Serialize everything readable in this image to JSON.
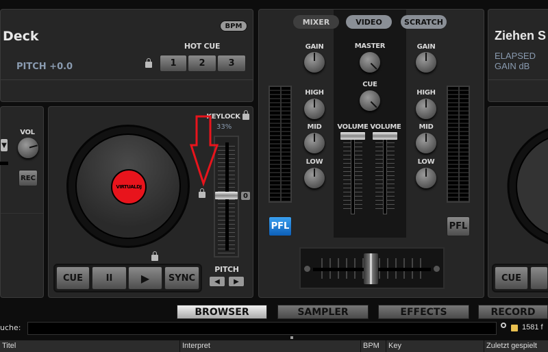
{
  "left_deck": {
    "title": "Deck",
    "pitch": "PITCH +0.0",
    "bpm_button": "BPM",
    "hot_cue_label": "HOT CUE",
    "hot_cues": [
      "1",
      "2",
      "3"
    ],
    "keylock_label": "KEYLOCK",
    "keylock_value": "33%",
    "vol_label": "VOL",
    "rec_button": "REC",
    "jog_logo": "VIRTUALDJ",
    "pitch_zero": "0",
    "pitch_label": "PITCH",
    "transport": {
      "cue": "CUE",
      "pause": "II",
      "play": "▶",
      "sync": "SYNC"
    },
    "pitch_left": "◀",
    "pitch_right": "▶",
    "down_button": "▼"
  },
  "mixer": {
    "tabs": [
      "MIXER",
      "VIDEO",
      "SCRATCH"
    ],
    "left": {
      "gain": "GAIN",
      "high": "HIGH",
      "mid": "MID",
      "low": "LOW",
      "pfl": "PFL"
    },
    "right": {
      "gain": "GAIN",
      "high": "HIGH",
      "mid": "MID",
      "low": "LOW",
      "pfl": "PFL"
    },
    "master": "MASTER",
    "cue": "CUE",
    "volume_left": "VOLUME",
    "volume_right": "VOLUME",
    "accent": "#1a7fd8"
  },
  "right_deck": {
    "title": "Ziehen S",
    "elapsed": "ELAPSED",
    "gain": "GAIN dB",
    "cue": "CUE"
  },
  "bottom_tabs": [
    "BROWSER",
    "SAMPLER",
    "EFFECTS",
    "RECORD"
  ],
  "search": {
    "label": "uche:",
    "value": "",
    "file_count": "1581 f"
  },
  "columns": [
    "Titel",
    "Interpret",
    "BPM",
    "Key",
    "Zuletzt gespielt"
  ]
}
